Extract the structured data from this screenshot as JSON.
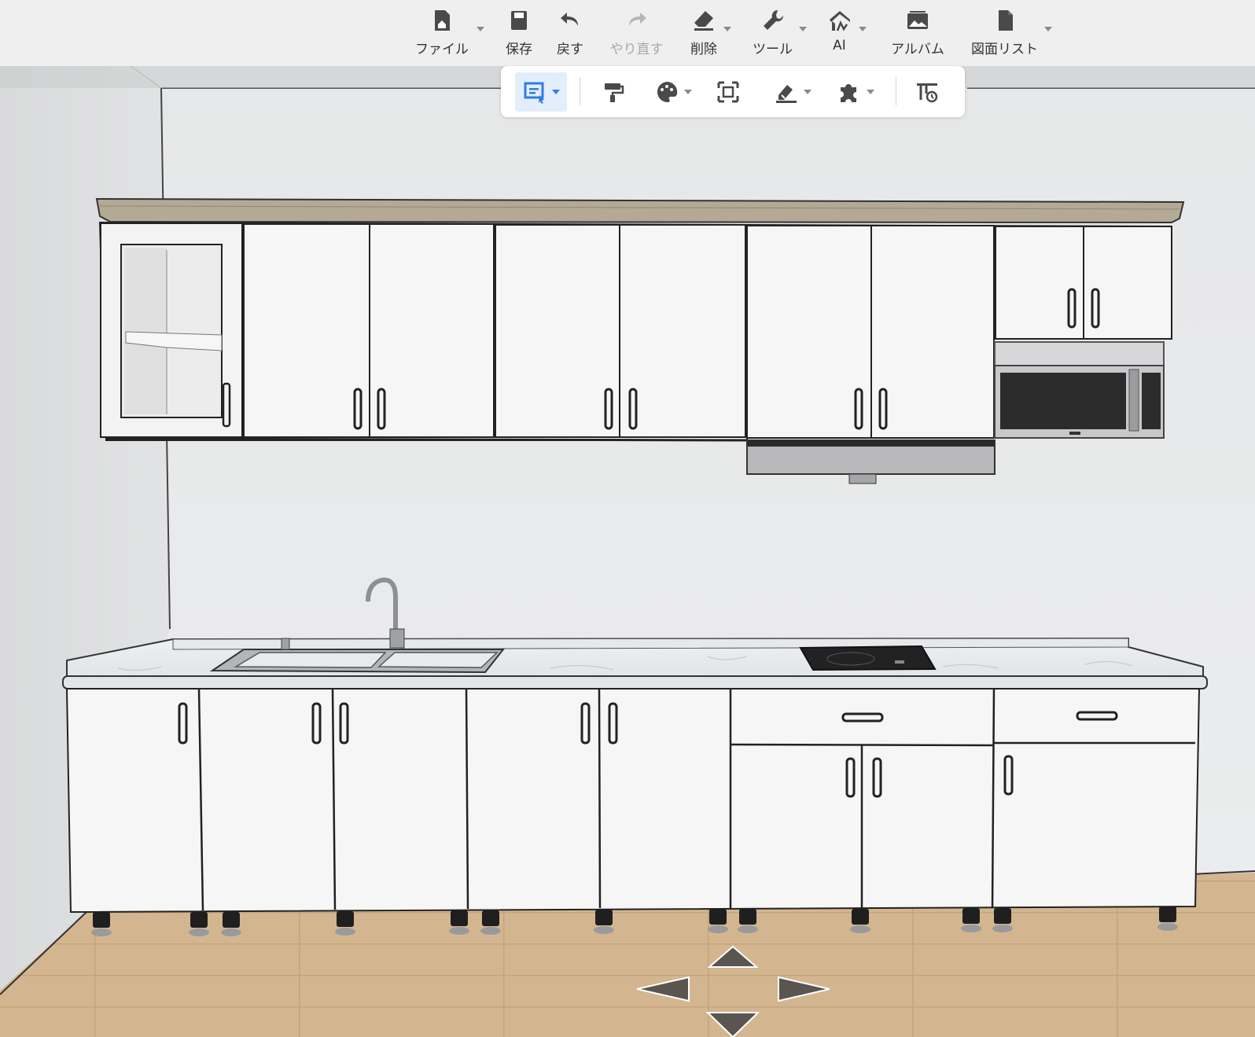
{
  "toolbar": {
    "items": [
      {
        "label": "ファイル",
        "icon": "file-home-icon",
        "has_menu": true
      },
      {
        "label": "保存",
        "icon": "save-icon",
        "has_menu": false
      },
      {
        "label": "戻す",
        "icon": "undo-icon",
        "has_menu": false
      },
      {
        "label": "やり直す",
        "icon": "redo-icon",
        "has_menu": false,
        "disabled": true
      },
      {
        "label": "削除",
        "icon": "eraser-icon",
        "has_menu": true
      },
      {
        "label": "ツール",
        "icon": "wrench-icon",
        "has_menu": true
      },
      {
        "label": "AI",
        "icon": "ai-house-icon",
        "has_menu": true
      },
      {
        "label": "アルバム",
        "icon": "album-icon",
        "has_menu": false
      },
      {
        "label": "図面リスト",
        "icon": "drawing-list-icon",
        "has_menu": true
      }
    ]
  },
  "subtoolbar": {
    "items": [
      {
        "icon": "select-tool-icon",
        "active": true,
        "has_menu": true
      },
      {
        "icon": "paint-roller-icon",
        "active": false,
        "has_menu": false
      },
      {
        "icon": "material-palette-icon",
        "active": false,
        "has_menu": true
      },
      {
        "icon": "frame-select-icon",
        "active": false,
        "has_menu": false
      },
      {
        "icon": "measure-tool-icon",
        "active": false,
        "has_menu": true
      },
      {
        "icon": "plugin-puzzle-icon",
        "active": false,
        "has_menu": true
      },
      {
        "icon": "view-settings-icon",
        "active": false,
        "has_menu": false
      }
    ]
  },
  "colors": {
    "accent": "#2f7ee0",
    "toolbar_bg": "#efefef",
    "wall": "#e9eaeb",
    "floor": "#d1b48e",
    "cabinet": "#f6f6f6",
    "crown_molding": "#b3a995"
  },
  "navigation": {
    "arrows": [
      "nav-up-arrow",
      "nav-left-arrow",
      "nav-right-arrow",
      "nav-down-arrow"
    ]
  }
}
